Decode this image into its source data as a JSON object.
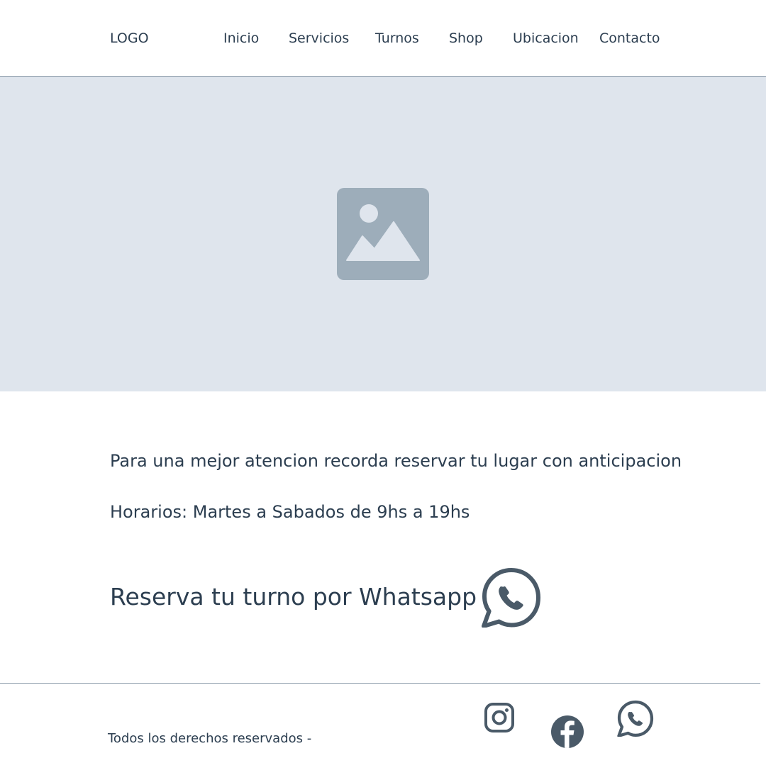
{
  "header": {
    "logo": "LOGO",
    "nav": [
      {
        "label": "Inicio"
      },
      {
        "label": "Servicios"
      },
      {
        "label": "Turnos"
      },
      {
        "label": "Shop"
      },
      {
        "label": "Ubicacion"
      },
      {
        "label": "Contacto"
      }
    ]
  },
  "hero": {
    "image_icon": "image-placeholder-icon"
  },
  "content": {
    "reminder": "Para una mejor atencion recorda reservar tu lugar con anticipacion",
    "hours": "Horarios: Martes a Sabados de 9hs a 19hs",
    "cta": "Reserva tu turno por Whatsapp",
    "cta_icon": "whatsapp-icon"
  },
  "footer": {
    "copyright": "Todos los derechos reservados -",
    "social": [
      {
        "icon": "instagram-icon"
      },
      {
        "icon": "facebook-icon"
      },
      {
        "icon": "whatsapp-icon"
      }
    ]
  },
  "colors": {
    "text": "#2c3e50",
    "icon": "#4a5a68",
    "hero_bg": "#dfe5ed",
    "placeholder": "#9dadba",
    "divider": "#8a9aa8"
  }
}
